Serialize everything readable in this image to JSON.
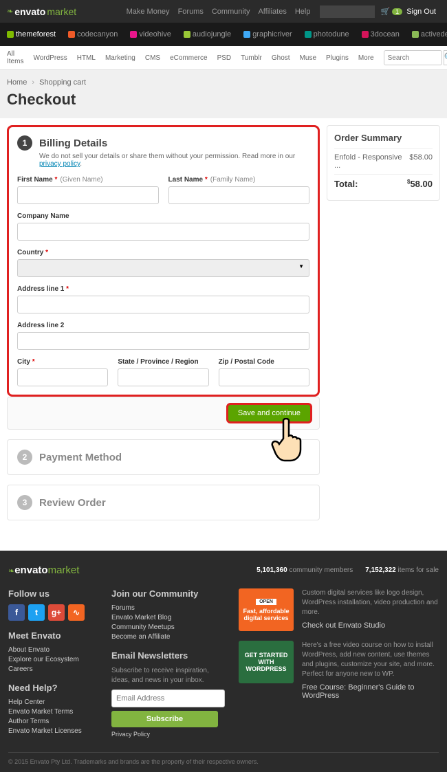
{
  "topbar": {
    "logo_env": "envato",
    "logo_mkt": "market",
    "links": [
      "Make Money",
      "Forums",
      "Community",
      "Affiliates",
      "Help"
    ],
    "cart_count": "1",
    "signout": "Sign Out"
  },
  "navbar": [
    {
      "key": "themeforest",
      "label": "themeforest"
    },
    {
      "key": "codecanyon",
      "label": "codecanyon"
    },
    {
      "key": "videohive",
      "label": "videohive"
    },
    {
      "key": "audiojungle",
      "label": "audiojungle"
    },
    {
      "key": "graphicriver",
      "label": "graphicriver"
    },
    {
      "key": "photodune",
      "label": "photodune"
    },
    {
      "key": "threedocean",
      "label": "3docean"
    },
    {
      "key": "activeden",
      "label": "activeden"
    }
  ],
  "categories": [
    "All Items",
    "WordPress",
    "HTML",
    "Marketing",
    "CMS",
    "eCommerce",
    "PSD",
    "Tumblr",
    "Ghost",
    "Muse",
    "Plugins",
    "More"
  ],
  "search_placeholder": "Search",
  "breadcrumb": {
    "home": "Home",
    "cart": "Shopping cart"
  },
  "page_title": "Checkout",
  "billing": {
    "step": "1",
    "title": "Billing Details",
    "subtitle_pre": "We do not sell your details or share them without your permission. Read more in our ",
    "subtitle_link": "privacy policy",
    "first_name": "First Name",
    "first_hint": "(Given Name)",
    "last_name": "Last Name",
    "last_hint": "(Family Name)",
    "company": "Company Name",
    "country": "Country",
    "addr1": "Address line 1",
    "addr2": "Address line 2",
    "city": "City",
    "state": "State / Province / Region",
    "zip": "Zip / Postal Code"
  },
  "save_btn": "Save and continue",
  "step2": {
    "num": "2",
    "title": "Payment Method"
  },
  "step3": {
    "num": "3",
    "title": "Review Order"
  },
  "summary": {
    "title": "Order Summary",
    "item": "Enfold - Responsive ...",
    "item_price": "$58.00",
    "total_label": "Total:",
    "total_cur": "$",
    "total_price": "58.00"
  },
  "footer": {
    "members_n": "5,101,360",
    "members_t": "community members",
    "items_n": "7,152,322",
    "items_t": "items for sale",
    "follow": "Follow us",
    "meet": "Meet Envato",
    "meet_links": [
      "About Envato",
      "Explore our Ecosystem",
      "Careers"
    ],
    "help": "Need Help?",
    "help_links": [
      "Help Center",
      "Envato Market Terms",
      "Author Terms",
      "Envato Market Licenses"
    ],
    "join": "Join our Community",
    "join_links": [
      "Forums",
      "Envato Market Blog",
      "Community Meetups",
      "Become an Affiliate"
    ],
    "news": "Email Newsletters",
    "news_sub": "Subscribe to receive inspiration, ideas, and news in your inbox.",
    "email_ph": "Email Address",
    "subscribe": "Subscribe",
    "privacy": "Privacy Policy",
    "promo1_img": "Fast, affordable digital services",
    "promo1_txt": "Custom digital services like logo design, WordPress installation, video production and more.",
    "promo1_link": "Check out Envato Studio",
    "promo2_img": "GET STARTED WITH WORDPRESS",
    "promo2_txt": "Here's a free video course on how to install WordPress, add new content, use themes and plugins, customize your site, and more. Perfect for anyone new to WP.",
    "promo2_link": "Free Course: Beginner's Guide to WordPress",
    "copyright": "© 2015 Envato Pty Ltd. Trademarks and brands are the property of their respective owners."
  }
}
